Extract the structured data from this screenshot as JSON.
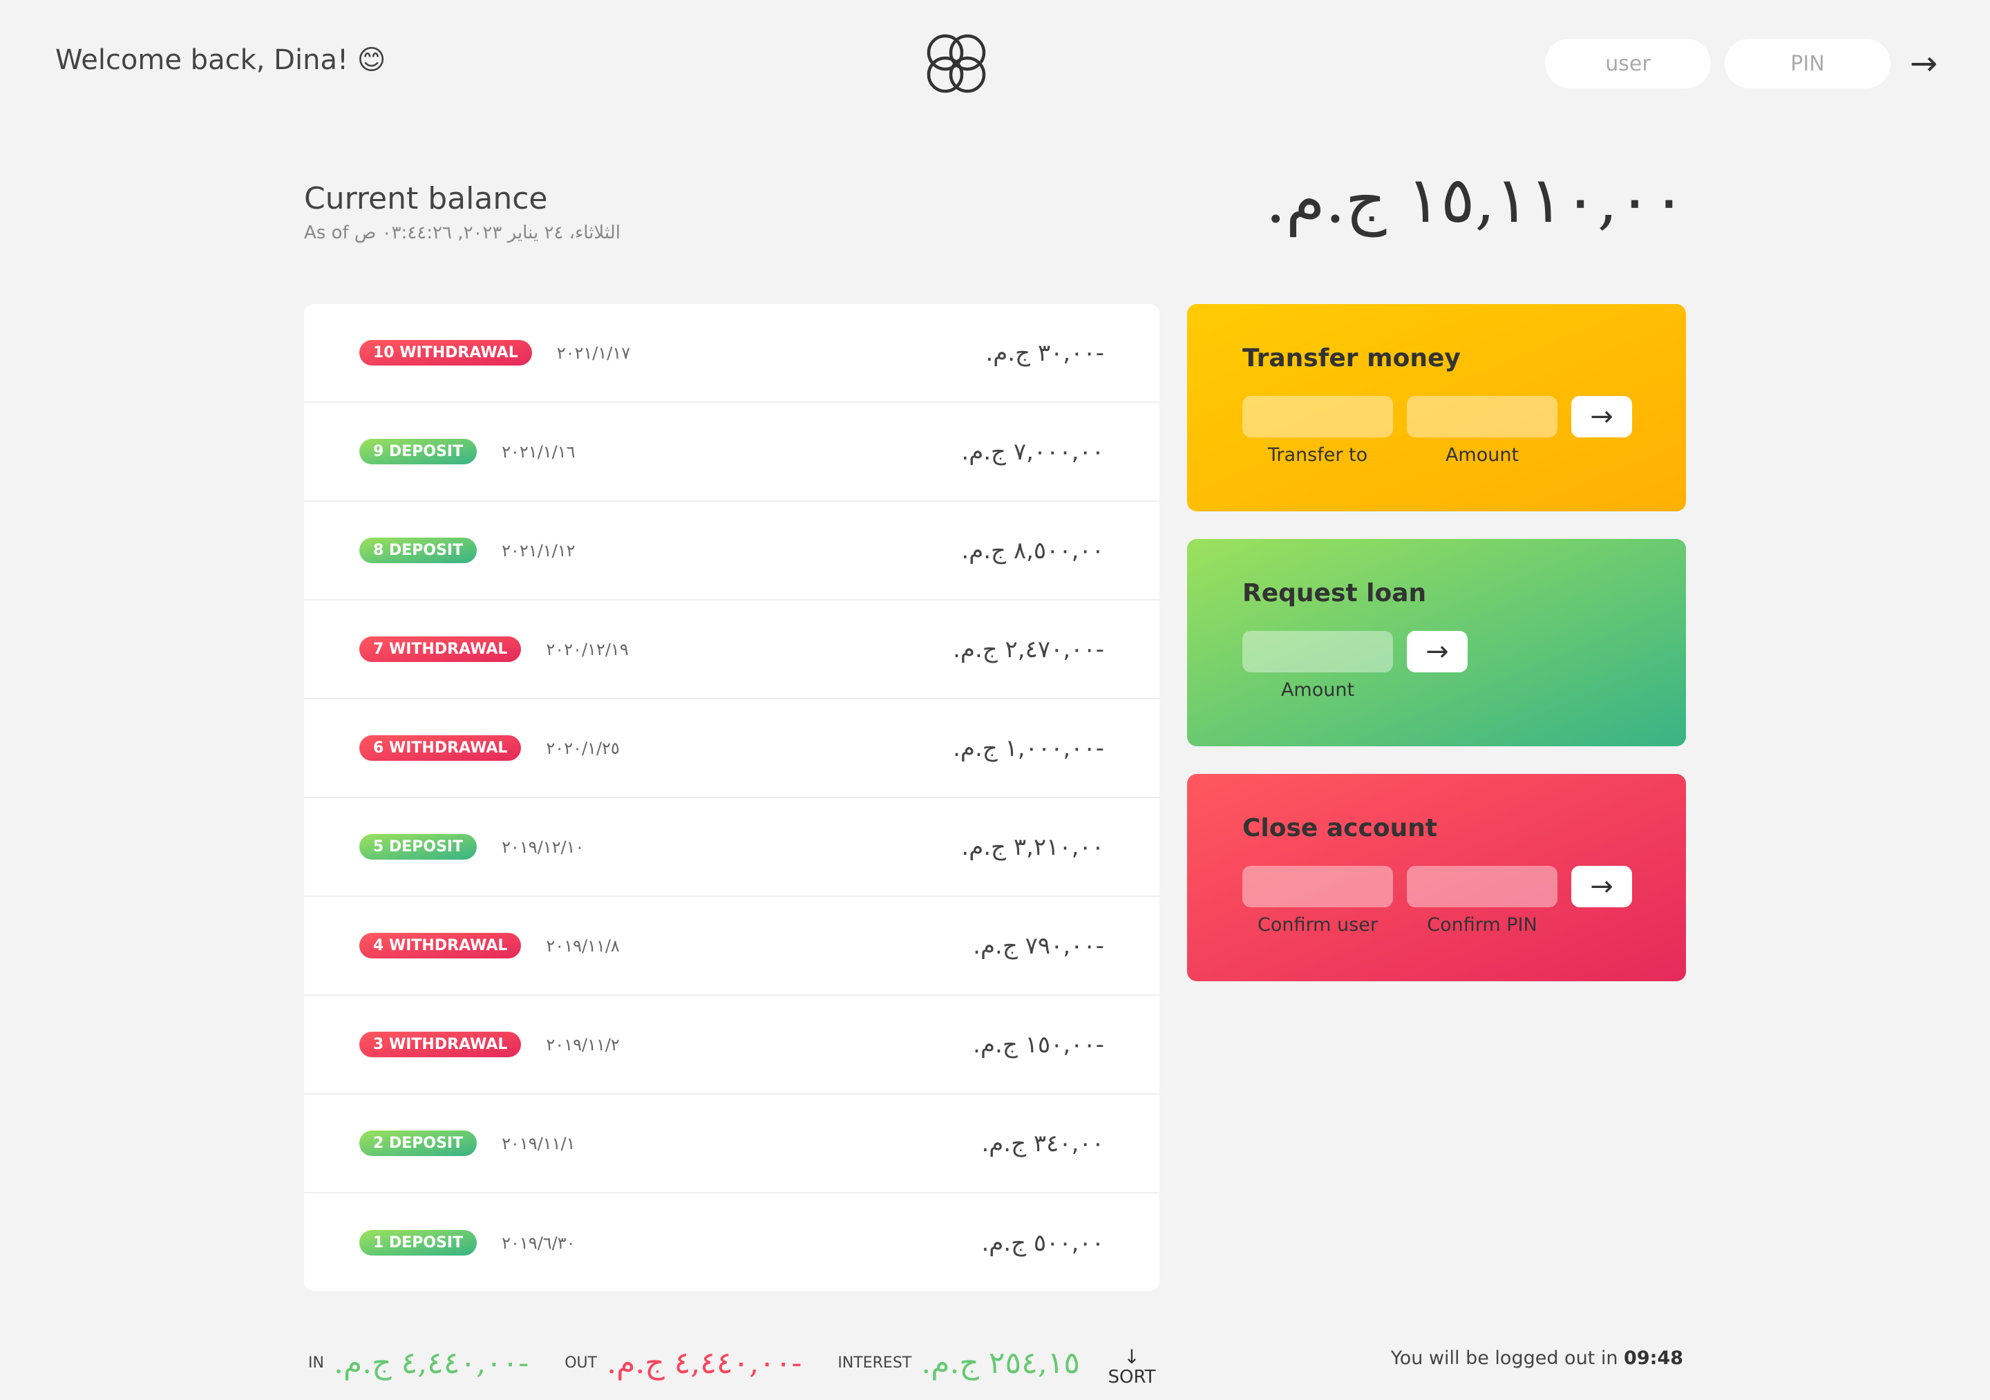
{
  "nav": {
    "welcome": "Welcome back, Dina! 😊",
    "user_placeholder": "user",
    "pin_placeholder": "PIN",
    "login_icon": "→"
  },
  "balance": {
    "label": "Current balance",
    "date": "As of الثلاثاء، ٢٤ يناير ٢٠٢٣, ٠٣:٤٤:٢٦ ص",
    "value": "١٥,١١٠,٠٠ ج.م."
  },
  "movements": [
    {
      "type_label": "10 withdrawal",
      "kind": "withdrawal",
      "date": "٢٠٢١/١/١٧",
      "value": "-٣٠,٠٠ ج.م."
    },
    {
      "type_label": "9 deposit",
      "kind": "deposit",
      "date": "٢٠٢١/١/١٦",
      "value": "٧,٠٠٠,٠٠ ج.م."
    },
    {
      "type_label": "8 deposit",
      "kind": "deposit",
      "date": "٢٠٢١/١/١٢",
      "value": "٨,٥٠٠,٠٠ ج.م."
    },
    {
      "type_label": "7 withdrawal",
      "kind": "withdrawal",
      "date": "٢٠٢٠/١٢/١٩",
      "value": "-٢,٤٧٠,٠٠ ج.م."
    },
    {
      "type_label": "6 withdrawal",
      "kind": "withdrawal",
      "date": "٢٠٢٠/١/٢٥",
      "value": "-١,٠٠٠,٠٠ ج.م."
    },
    {
      "type_label": "5 deposit",
      "kind": "deposit",
      "date": "٢٠١٩/١٢/١٠",
      "value": "٣,٢١٠,٠٠ ج.م."
    },
    {
      "type_label": "4 withdrawal",
      "kind": "withdrawal",
      "date": "٢٠١٩/١١/٨",
      "value": "-٧٩٠,٠٠ ج.م."
    },
    {
      "type_label": "3 withdrawal",
      "kind": "withdrawal",
      "date": "٢٠١٩/١١/٢",
      "value": "-١٥٠,٠٠ ج.م."
    },
    {
      "type_label": "2 deposit",
      "kind": "deposit",
      "date": "٢٠١٩/١١/١",
      "value": "٣٤٠,٠٠ ج.م."
    },
    {
      "type_label": "1 deposit",
      "kind": "deposit",
      "date": "٢٠١٩/٦/٣٠",
      "value": "٥٠٠,٠٠ ج.م."
    }
  ],
  "operations": {
    "transfer": {
      "title": "Transfer money",
      "label_to": "Transfer to",
      "label_amount": "Amount",
      "button": "→"
    },
    "loan": {
      "title": "Request loan",
      "label_amount": "Amount",
      "button": "→"
    },
    "close": {
      "title": "Close account",
      "label_user": "Confirm user",
      "label_pin": "Confirm PIN",
      "button": "→"
    }
  },
  "summary": {
    "in_label": "In",
    "in_value": "-٤,٤٤٠,٠٠ ج.م.",
    "out_label": "Out",
    "out_value": "-٤,٤٤٠,٠٠ ج.م.",
    "interest_label": "Interest",
    "interest_value": "٢٥٤,١٥ ج.م.",
    "sort_arrow": "↓",
    "sort_label": "SORT"
  },
  "logout": {
    "text": "You will be logged out in ",
    "timer": "09:48"
  },
  "colors": {
    "withdrawal": "#e52a5a",
    "deposit": "#39b385",
    "transfer": "#ffb003",
    "loan": "#39b385",
    "close": "#e52a5a"
  }
}
